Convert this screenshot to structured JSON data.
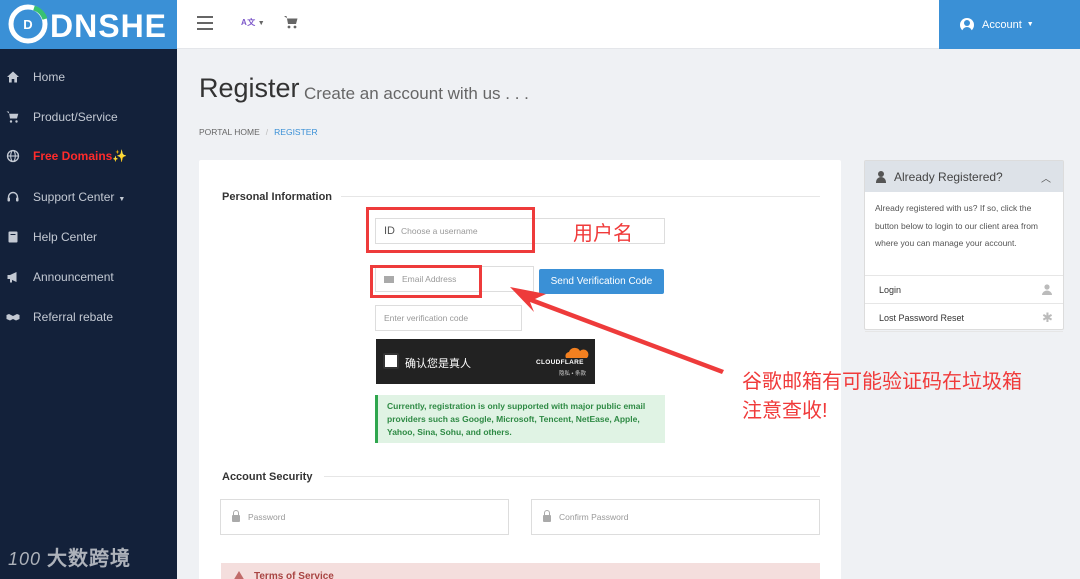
{
  "brand": {
    "name": "DNSHE",
    "logo_letter": "D"
  },
  "topbar": {
    "language_icon": "translate-icon",
    "account_label": "Account"
  },
  "sidebar": {
    "items": [
      {
        "label": "Home",
        "icon": "home-icon"
      },
      {
        "label": "Product/Service",
        "icon": "cart-icon"
      },
      {
        "label": "Free Domains✨",
        "icon": "globe-icon",
        "highlight": true
      },
      {
        "label": "Support Center",
        "icon": "headset-icon",
        "has_dropdown": true
      },
      {
        "label": "Help Center",
        "icon": "book-icon"
      },
      {
        "label": "Announcement",
        "icon": "megaphone-icon"
      },
      {
        "label": "Referral rebate",
        "icon": "handshake-icon"
      }
    ],
    "watermark": {
      "logo": "100",
      "text": "大数跨境"
    }
  },
  "page": {
    "title": "Register",
    "subtitle": "Create an account with us . . .",
    "breadcrumb": {
      "home": "Portal Home",
      "current": "Register"
    }
  },
  "form": {
    "personal_title": "Personal Information",
    "username": {
      "prefix": "ID",
      "placeholder": "Choose a username"
    },
    "email": {
      "placeholder": "Email Address"
    },
    "send_code_label": "Send Verification Code",
    "verification_placeholder": "Enter verification code",
    "captcha": {
      "checkbox_label": "确认您是真人",
      "provider": "CLOUDFLARE",
      "links": "隐私 • 条款"
    },
    "notice": "Currently, registration is only supported with major public email providers such as Google, Microsoft, Tencent, NetEase, Apple, Yahoo, Sina, Sohu, and others.",
    "security_title": "Account Security",
    "password_placeholder": "Password",
    "confirm_password_placeholder": "Confirm Password",
    "tos_label": "Terms of Service"
  },
  "panel": {
    "title": "Already Registered?",
    "body": "Already registered with us? If so, click the button below to login to our client area from where you can manage your account.",
    "links": [
      "Login",
      "Lost Password Reset"
    ]
  },
  "annotations": {
    "username_note": "用户名",
    "email_note_line1": "谷歌邮箱有可能验证码在垃圾箱",
    "email_note_line2": "注意查收!"
  },
  "colors": {
    "brand_blue": "#3a90d6",
    "sidebar_bg": "#13213a",
    "annotation_red": "#ee3b3b",
    "notice_green": "#2fa64e"
  }
}
